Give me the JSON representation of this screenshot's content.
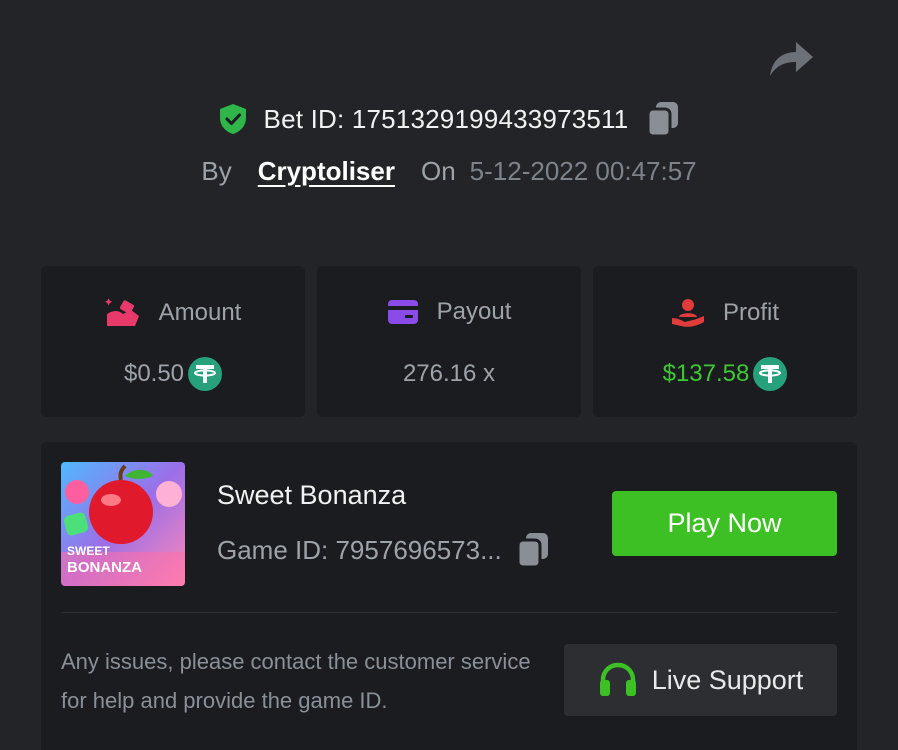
{
  "bet": {
    "id_label": "Bet ID: 1751329199433973511",
    "by_label": "By",
    "user": "Cryptoliser",
    "on_label": "On",
    "datetime": "5-12-2022 00:47:57"
  },
  "stats": {
    "amount": {
      "label": "Amount",
      "value": "$0.50",
      "icon": "coins-hand-icon",
      "color": "#e8396b"
    },
    "payout": {
      "label": "Payout",
      "value": "276.16 x",
      "icon": "wallet-card-icon",
      "color": "#8a4be8"
    },
    "profit": {
      "label": "Profit",
      "value": "$137.58",
      "icon": "hand-user-icon",
      "color": "#e23b3b"
    }
  },
  "game": {
    "title": "Sweet Bonanza",
    "id_label": "Game ID: 7957696573...",
    "thumb_text_1": "SWEET",
    "thumb_text_2": "BONANZA",
    "play_label": "Play Now"
  },
  "help": {
    "text": "Any issues, please contact the customer service for help and provide the game ID.",
    "support_label": "Live Support"
  },
  "colors": {
    "background": "#232427",
    "card": "#1b1c1f",
    "accent_green": "#3cc024",
    "profit_green": "#3cc933",
    "tether": "#26a17b"
  }
}
